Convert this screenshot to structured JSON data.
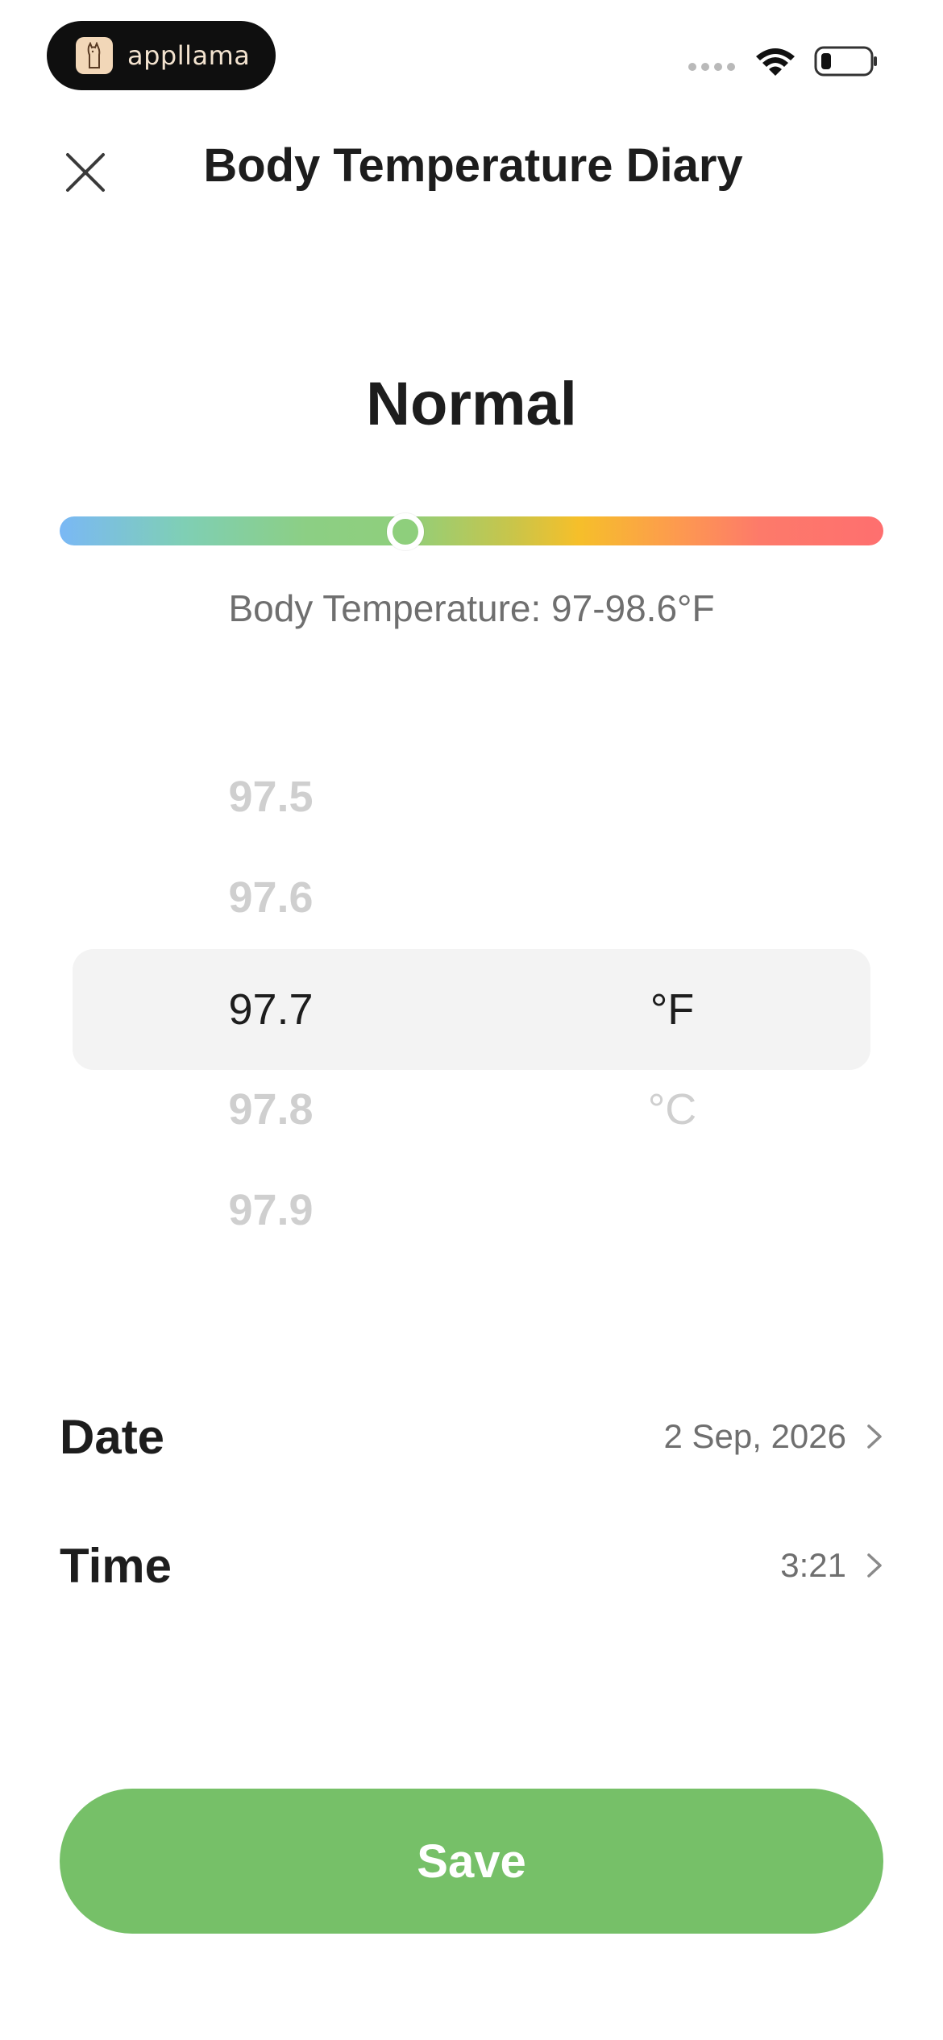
{
  "status_bar": {
    "brand": "appllama",
    "colors": {
      "pill": "#0f0f0f",
      "brand_text": "#f3e3cf"
    }
  },
  "header": {
    "title": "Body Temperature Diary",
    "close_icon": "close-icon"
  },
  "status": {
    "heading": "Normal",
    "range_label": "Body Temperature: 97-98.6°F",
    "scale_level": 0.42,
    "colors": {
      "low": "#7ab8f5",
      "normal": "#8ccf84",
      "elevated": "#f6bf2a",
      "high": "#fe6f6f"
    }
  },
  "picker": {
    "values": [
      "97.5",
      "97.6",
      "97.7",
      "97.8",
      "97.9"
    ],
    "selected_value": "97.7",
    "units": [
      "°F",
      "°C"
    ],
    "selected_unit": "°F"
  },
  "details": {
    "date_label": "Date",
    "date_value": "2 Sep, 2026",
    "time_label": "Time",
    "time_value": "3:21"
  },
  "save": {
    "label": "Save",
    "color": "#76c068"
  }
}
